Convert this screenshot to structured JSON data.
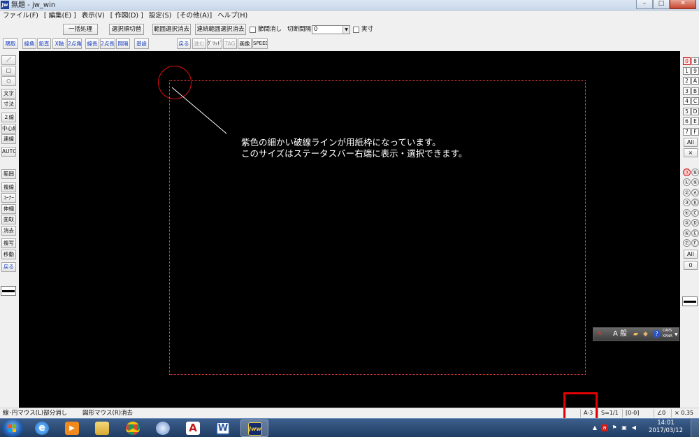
{
  "window": {
    "icon_text": "Jw",
    "title": "無題 - jw_win",
    "minimize": "–",
    "maximize": "□",
    "close": "✕"
  },
  "menu": [
    "ファイル(F)",
    "[ 編集(E) ]",
    "表示(V)",
    "[ 作図(D) ]",
    "設定(S)",
    "[その他(A)]",
    "ヘルプ(H)"
  ],
  "toolbar1": {
    "batch": "一括処理",
    "select_order": "選択順切替",
    "range_clear": "範囲選択消去",
    "continuous_clear": "連続範囲選択消去",
    "node_clear_label": "節間消し",
    "cut_interval_label": "切断間隔",
    "cut_interval_value": "0",
    "actual_size_label": "実寸"
  },
  "toolbar2": {
    "left": [
      "隅取",
      "線角",
      "鉛直",
      "X軸",
      "2点角",
      "線長",
      "2点長",
      "間隔",
      "基設"
    ],
    "right": [
      "戻る",
      "進む",
      "ｸﾞﾘｯﾄﾞ",
      "TAG",
      "画像",
      "SPEED"
    ]
  },
  "left_palette": {
    "group1": [
      "／",
      "□",
      "○",
      "文字",
      "寸法",
      "２線",
      "中心線",
      "連線",
      "AUTO"
    ],
    "group2": [
      "範囲",
      "複線",
      "ｺｰﾅｰ",
      "伸縮",
      "面取",
      "消去",
      "複写",
      "移動",
      "戻る"
    ]
  },
  "right_palette": {
    "group_layers": [
      "0",
      "8",
      "1",
      "9",
      "2",
      "A",
      "3",
      "B",
      "4",
      "C",
      "5",
      "D",
      "6",
      "E",
      "7",
      "F"
    ],
    "group_layers_circled": [
      "⓪",
      "⑧",
      "①",
      "⑨",
      "②",
      "Ⓐ",
      "③",
      "Ⓑ",
      "④",
      "Ⓒ",
      "⑤",
      "Ⓓ",
      "⑥",
      "Ⓔ",
      "⑦",
      "Ⓕ"
    ],
    "all": "All",
    "cross": "×",
    "all2": "All",
    "zero": "0"
  },
  "annotation": {
    "line1": "紫色の細かい破線ラインが用紙枠になっています。",
    "line2": "このサイズはステータスバー右端に表示・選択できます。"
  },
  "ime": {
    "mode": "A 般",
    "caps": "CAPS",
    "kana": "KANA"
  },
  "statusbar": {
    "left1": "線･円マウス(L)部分消し",
    "left2": "図形マウス(R)消去",
    "paper": "A-3",
    "scale": "S=1/1",
    "layer": "[0-0]",
    "angle": "∠0",
    "zoom": "× 0.35"
  },
  "taskbar": {
    "time": "14:01",
    "date": "2017/03/12"
  },
  "colors": {
    "canvas": "#000000",
    "paper_frame": "#ff4a4a",
    "highlight": "#e20000",
    "active_layer": "#d01010"
  }
}
